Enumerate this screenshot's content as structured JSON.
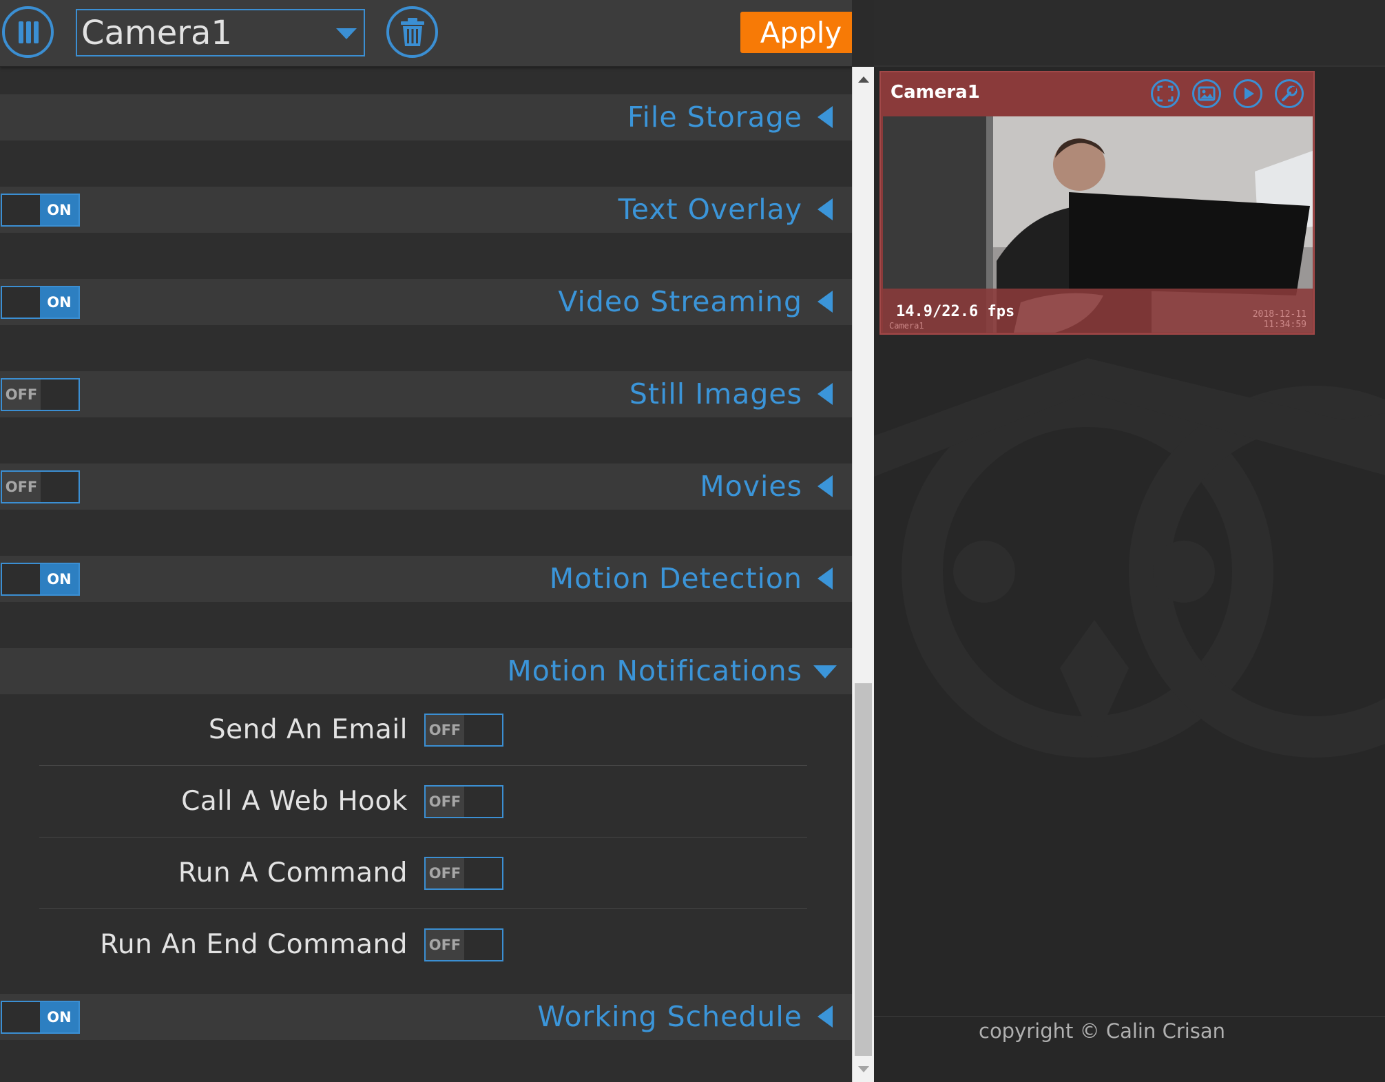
{
  "header": {
    "camera_selected": "Camera1",
    "apply_label": "Apply"
  },
  "sections": [
    {
      "title": "File Storage",
      "toggle": null,
      "expanded": false
    },
    {
      "title": "Text Overlay",
      "toggle": "ON",
      "expanded": false
    },
    {
      "title": "Video Streaming",
      "toggle": "ON",
      "expanded": false
    },
    {
      "title": "Still Images",
      "toggle": "OFF",
      "expanded": false
    },
    {
      "title": "Movies",
      "toggle": "OFF",
      "expanded": false
    },
    {
      "title": "Motion Detection",
      "toggle": "ON",
      "expanded": false
    },
    {
      "title": "Motion Notifications",
      "toggle": null,
      "expanded": true
    },
    {
      "title": "Working Schedule",
      "toggle": "ON",
      "expanded": false
    }
  ],
  "motion_notifications": [
    {
      "label": "Send An Email",
      "toggle": "OFF"
    },
    {
      "label": "Call A Web Hook",
      "toggle": "OFF"
    },
    {
      "label": "Run A Command",
      "toggle": "OFF"
    },
    {
      "label": "Run An End Command",
      "toggle": "OFF"
    }
  ],
  "camera_preview": {
    "name": "Camera1",
    "fps": "14.9/22.6 fps",
    "overlay_left": "Camera1",
    "overlay_date": "2018-12-11",
    "overlay_time": "11:34:59",
    "icons": [
      "fullscreen-icon",
      "pictures-icon",
      "play-icon",
      "settings-wrench-icon"
    ]
  },
  "footer": {
    "copyright": "copyright © Calin Crisan"
  },
  "colors": {
    "accent": "#3b8fd3",
    "apply": "#f77a06",
    "camera_frame": "#8a3a3a"
  }
}
